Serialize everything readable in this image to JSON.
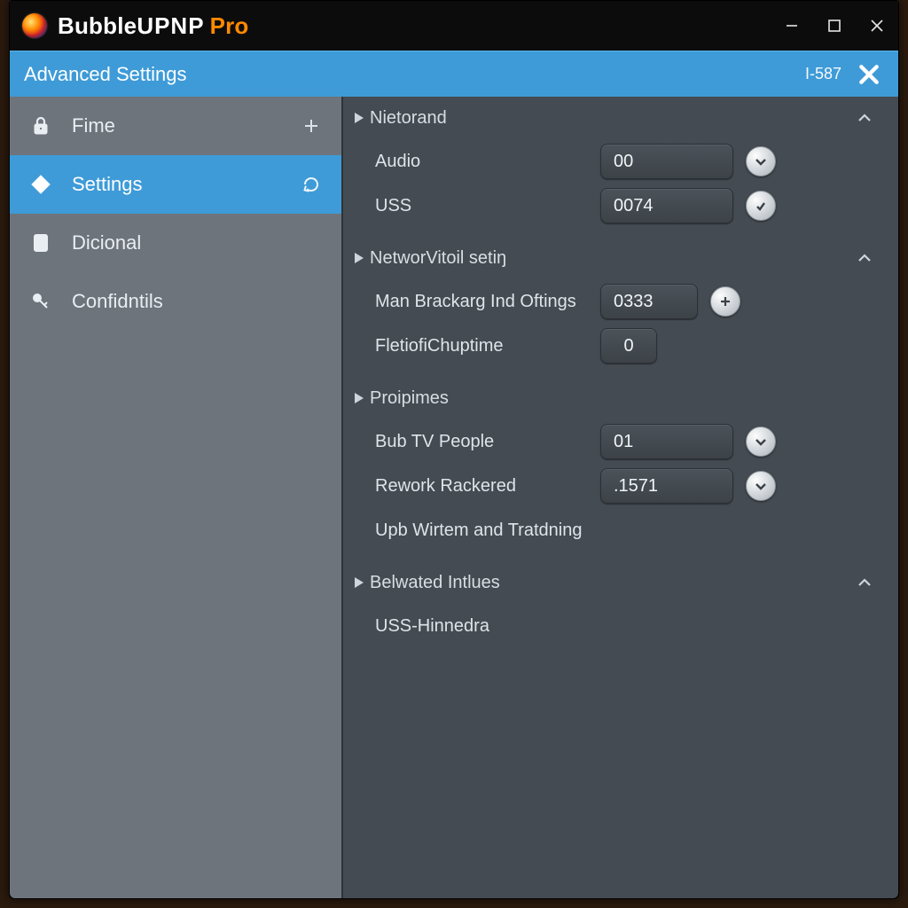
{
  "title": {
    "brand1": "Bubble",
    "brand2": "UPNP",
    "pro": "Pro"
  },
  "header": {
    "title": "Advanced Settings",
    "code": "I-587"
  },
  "sidebar": {
    "items": [
      {
        "label": "Fime"
      },
      {
        "label": "Settings"
      },
      {
        "label": "Dicional"
      },
      {
        "label": "Confidntils"
      }
    ]
  },
  "groups": {
    "g1": {
      "title": "Nietorand",
      "r1": {
        "label": "Audio",
        "value": "00"
      },
      "r2": {
        "label": "USS",
        "value": "0074"
      }
    },
    "g2": {
      "title": "NetworVitoil setiŋ",
      "r1": {
        "label": "Man Brackarg Ind Oftings",
        "value": "0333"
      },
      "r2": {
        "label": "FletiofiChuptime",
        "value": "0"
      }
    },
    "g3": {
      "title": "Proipimes",
      "r1": {
        "label": "Bub TV People",
        "value": "01"
      },
      "r2": {
        "label": "Rework Rackered",
        "value": ".1571"
      },
      "r3": {
        "label": "Upb Wirtem and Tratdning"
      }
    },
    "g4": {
      "title": "Belwated Intlues",
      "r1": {
        "label": "USS-Hinnedra"
      }
    }
  }
}
